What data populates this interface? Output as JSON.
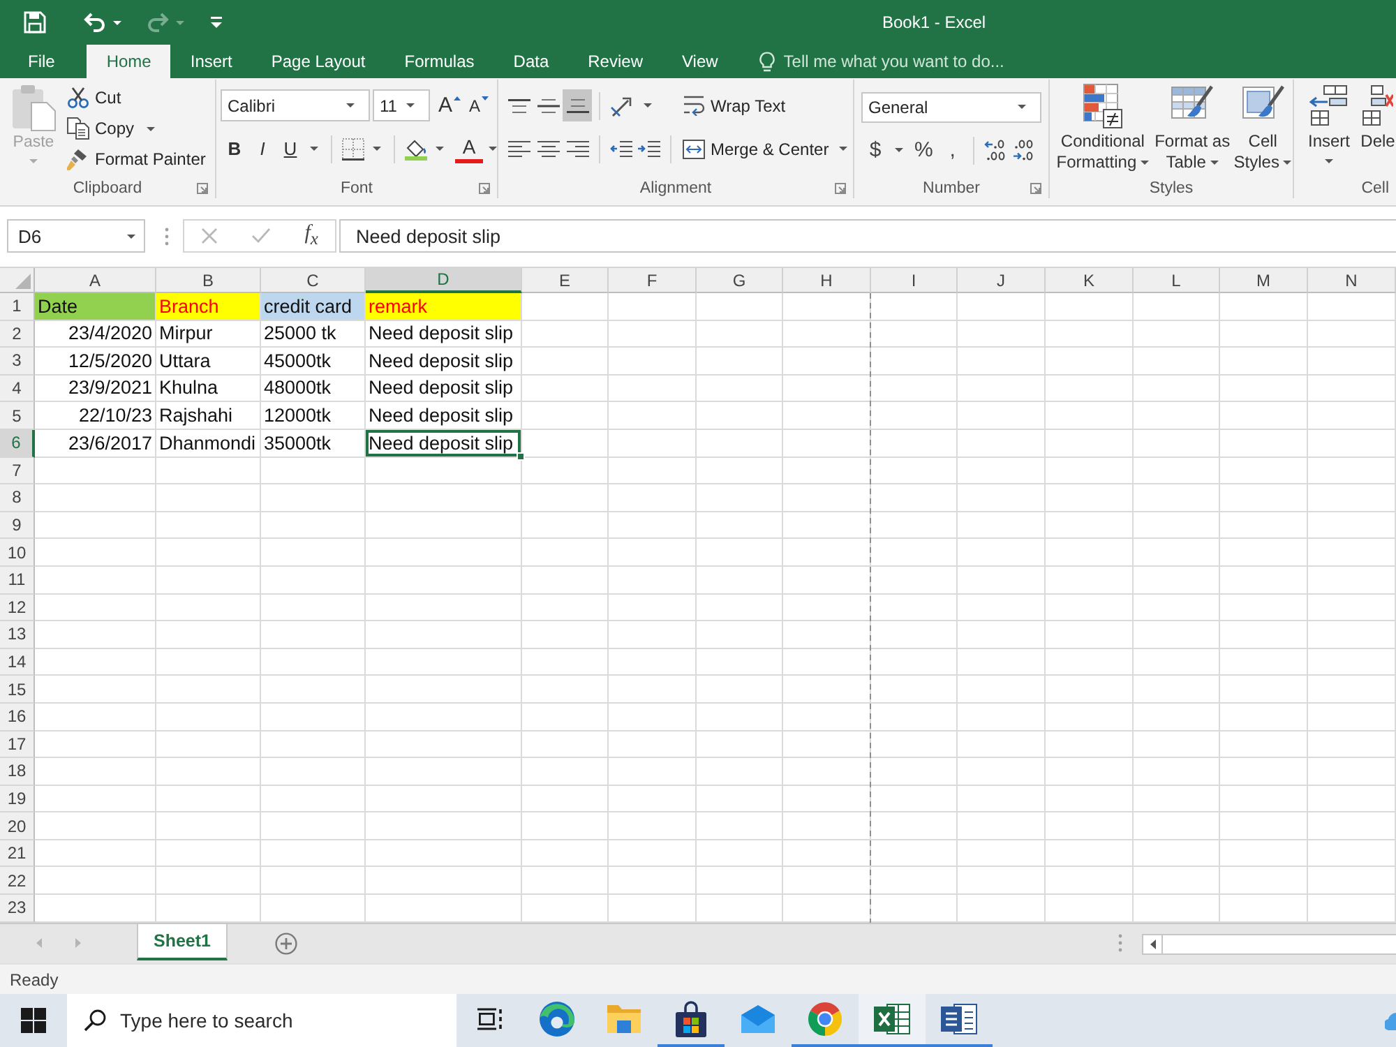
{
  "window": {
    "title": "Book1 - Excel"
  },
  "quick_access": [
    {
      "kind": "save",
      "disabled": false
    },
    {
      "kind": "undo",
      "disabled": false
    },
    {
      "kind": "redo",
      "disabled": true
    },
    {
      "kind": "customize",
      "disabled": false
    }
  ],
  "tabs": [
    {
      "label": "File",
      "selected": false
    },
    {
      "label": "Home",
      "selected": true
    },
    {
      "label": "Insert",
      "selected": false
    },
    {
      "label": "Page Layout",
      "selected": false
    },
    {
      "label": "Formulas",
      "selected": false
    },
    {
      "label": "Data",
      "selected": false
    },
    {
      "label": "Review",
      "selected": false
    },
    {
      "label": "View",
      "selected": false
    }
  ],
  "tell_me": {
    "placeholder": "Tell me what you want to do..."
  },
  "ribbon": {
    "clipboard": {
      "label": "Clipboard",
      "paste": {
        "label": "Paste",
        "disabled": true
      },
      "cut": "Cut",
      "copy": "Copy",
      "format_painter": "Format Painter"
    },
    "font": {
      "label": "Font",
      "font_name": "Calibri",
      "font_size": "11",
      "grow": "A",
      "shrink": "A",
      "bold": "B",
      "italic": "I",
      "underline": "U",
      "font_color": "A"
    },
    "alignment": {
      "label": "Alignment",
      "vertical": [
        {
          "kind": "top",
          "selected": false
        },
        {
          "kind": "middle",
          "selected": false
        },
        {
          "kind": "bottom",
          "selected": true
        }
      ],
      "horizontal": [
        {
          "kind": "left",
          "selected": false
        },
        {
          "kind": "center",
          "selected": false
        },
        {
          "kind": "right",
          "selected": false
        }
      ],
      "wrap_text": "Wrap Text",
      "merge_center": "Merge & Center"
    },
    "number": {
      "label": "Number",
      "format": "General",
      "currency": "$",
      "percent": "%",
      "comma": ","
    },
    "styles": {
      "label": "Styles",
      "buttons": [
        {
          "kind": "conditional",
          "label": "Conditional Formatting"
        },
        {
          "kind": "table",
          "label": "Format as Table"
        },
        {
          "kind": "cell",
          "label": "Cell Styles"
        }
      ]
    },
    "cells": {
      "label": "Cell",
      "buttons": [
        {
          "kind": "insert",
          "label": "Insert"
        },
        {
          "kind": "delete",
          "label": "Dele"
        }
      ]
    }
  },
  "name_box": {
    "value": "D6"
  },
  "formula_bar": {
    "function_label": "f$_{x}$",
    "value": "Need deposit slip"
  },
  "sheet": {
    "columns": [
      {
        "label": "A",
        "selected": false,
        "page_break": false
      },
      {
        "label": "B",
        "selected": false,
        "page_break": false
      },
      {
        "label": "C",
        "selected": false,
        "page_break": false
      },
      {
        "label": "D",
        "selected": true,
        "page_break": false
      },
      {
        "label": "E",
        "selected": false,
        "page_break": false
      },
      {
        "label": "F",
        "selected": false,
        "page_break": false
      },
      {
        "label": "G",
        "selected": false,
        "page_break": false
      },
      {
        "label": "H",
        "selected": false,
        "page_break": true
      },
      {
        "label": "I",
        "selected": false,
        "page_break": false
      },
      {
        "label": "J",
        "selected": false,
        "page_break": false
      },
      {
        "label": "K",
        "selected": false,
        "page_break": false
      },
      {
        "label": "L",
        "selected": false,
        "page_break": false
      },
      {
        "label": "M",
        "selected": false,
        "page_break": false
      },
      {
        "label": "N",
        "selected": false,
        "page_break": false
      }
    ],
    "rows": [
      {
        "label": "1",
        "selected": false,
        "cells": [
          {
            "text": "Date",
            "kind": "text",
            "color": "#92d050",
            "red_text": false,
            "selected": false
          },
          {
            "text": "Branch",
            "kind": "text",
            "color": "#ffff00",
            "red_text": true,
            "selected": false
          },
          {
            "text": "credit card",
            "kind": "text",
            "color": "#bdd7ee",
            "red_text": false,
            "selected": false
          },
          {
            "text": "remark",
            "kind": "text",
            "color": "#ffff00",
            "red_text": true,
            "selected": false
          }
        ]
      },
      {
        "label": "2",
        "selected": false,
        "cells": [
          {
            "text": "23/4/2020",
            "kind": "date",
            "selected": false
          },
          {
            "text": "Mirpur",
            "kind": "text",
            "selected": false
          },
          {
            "text": "25000 tk",
            "kind": "text",
            "selected": false
          },
          {
            "text": "Need deposit slip",
            "kind": "text",
            "selected": false
          }
        ]
      },
      {
        "label": "3",
        "selected": false,
        "cells": [
          {
            "text": "12/5/2020",
            "kind": "date",
            "selected": false
          },
          {
            "text": "Uttara",
            "kind": "text",
            "selected": false
          },
          {
            "text": "45000tk",
            "kind": "text",
            "selected": false
          },
          {
            "text": "Need deposit slip",
            "kind": "text",
            "selected": false
          }
        ]
      },
      {
        "label": "4",
        "selected": false,
        "cells": [
          {
            "text": "23/9/2021",
            "kind": "date",
            "selected": false
          },
          {
            "text": "Khulna",
            "kind": "text",
            "selected": false
          },
          {
            "text": "48000tk",
            "kind": "text",
            "selected": false
          },
          {
            "text": "Need deposit slip",
            "kind": "text",
            "selected": false
          }
        ]
      },
      {
        "label": "5",
        "selected": false,
        "cells": [
          {
            "text": "22/10/23",
            "kind": "date",
            "selected": false
          },
          {
            "text": "Rajshahi",
            "kind": "text",
            "selected": false
          },
          {
            "text": "12000tk",
            "kind": "text",
            "selected": false
          },
          {
            "text": "Need deposit slip",
            "kind": "text",
            "selected": false
          }
        ]
      },
      {
        "label": "6",
        "selected": true,
        "cells": [
          {
            "text": "23/6/2017",
            "kind": "date",
            "selected": false
          },
          {
            "text": "Dhanmondi",
            "kind": "text",
            "selected": false
          },
          {
            "text": "35000tk",
            "kind": "text",
            "selected": false
          },
          {
            "text": "Need deposit slip",
            "kind": "text",
            "selected": true
          }
        ]
      },
      {
        "label": "7",
        "selected": false
      },
      {
        "label": "8",
        "selected": false
      },
      {
        "label": "9",
        "selected": false
      },
      {
        "label": "10",
        "selected": false
      },
      {
        "label": "11",
        "selected": false
      },
      {
        "label": "12",
        "selected": false
      },
      {
        "label": "13",
        "selected": false
      },
      {
        "label": "14",
        "selected": false
      },
      {
        "label": "15",
        "selected": false
      },
      {
        "label": "16",
        "selected": false
      },
      {
        "label": "17",
        "selected": false
      },
      {
        "label": "18",
        "selected": false
      },
      {
        "label": "19",
        "selected": false
      },
      {
        "label": "20",
        "selected": false
      },
      {
        "label": "21",
        "selected": false
      },
      {
        "label": "22",
        "selected": false
      },
      {
        "label": "23",
        "selected": false
      }
    ]
  },
  "sheet_tabs": [
    {
      "label": "Sheet1",
      "selected": true
    }
  ],
  "status_bar": {
    "text": "Ready"
  },
  "taskbar": {
    "search": {
      "placeholder": "Type here to search"
    },
    "apps": [
      {
        "kind": "task-view",
        "running": false,
        "active": false
      },
      {
        "kind": "edge",
        "running": false,
        "active": false
      },
      {
        "kind": "explorer",
        "running": false,
        "active": false
      },
      {
        "kind": "store",
        "running": true,
        "active": false
      },
      {
        "kind": "mail",
        "running": false,
        "active": false
      },
      {
        "kind": "chrome",
        "running": true,
        "active": false
      },
      {
        "kind": "excel",
        "running": true,
        "active": true
      },
      {
        "kind": "word",
        "running": true,
        "active": false
      }
    ]
  }
}
